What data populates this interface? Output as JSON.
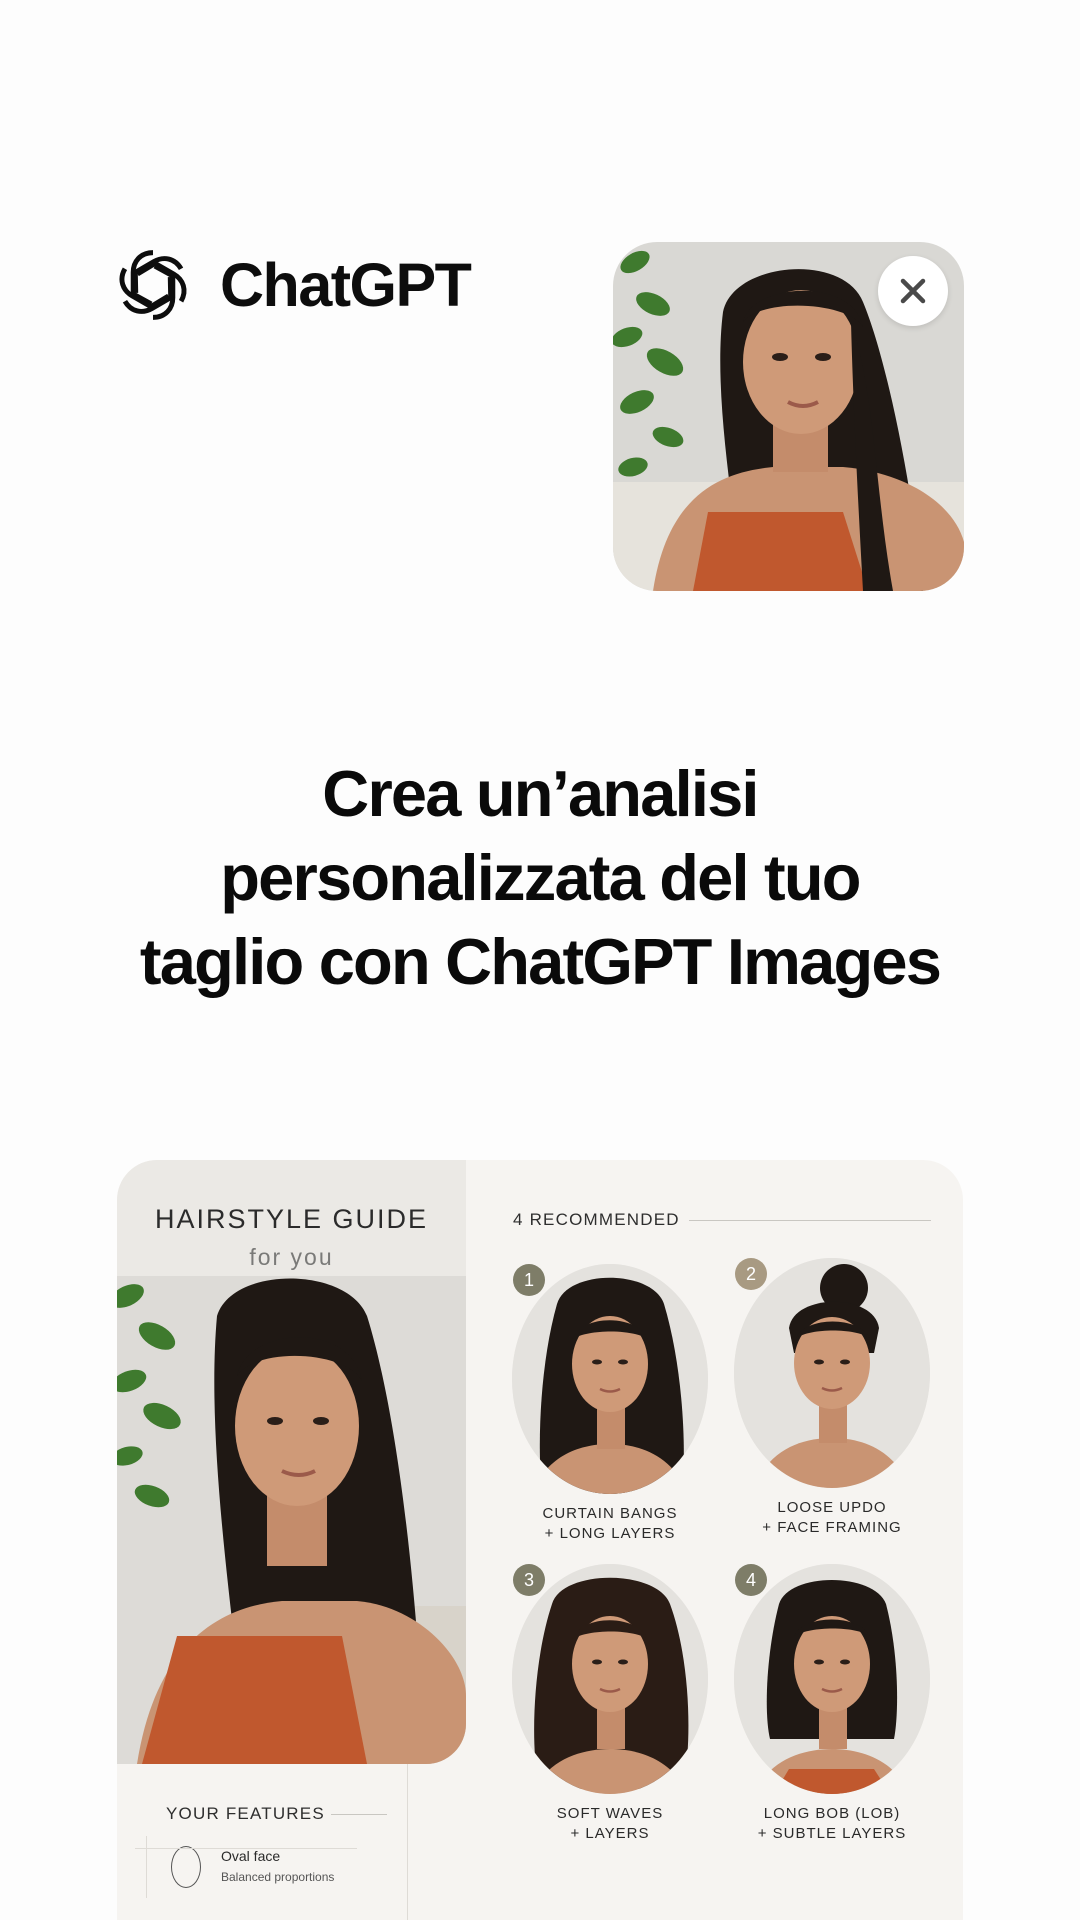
{
  "brand": {
    "name": "ChatGPT",
    "logo_icon": "openai-knot-icon"
  },
  "upload": {
    "close_icon": "close-icon"
  },
  "headline": {
    "line1": "Crea un’analisi",
    "line2": "personalizzata del tuo",
    "line3": "taglio con ChatGPT Images"
  },
  "guide": {
    "title": "HAIRSTYLE GUIDE",
    "subtitle": "for you",
    "recommended_header": "4 RECOMMENDED",
    "looks": [
      {
        "number": "1",
        "line1": "CURTAIN BANGS",
        "line2": "+ LONG LAYERS"
      },
      {
        "number": "2",
        "line1": "LOOSE UPDO",
        "line2": "+ FACE FRAMING"
      },
      {
        "number": "3",
        "line1": "SOFT WAVES",
        "line2": "+ LAYERS"
      },
      {
        "number": "4",
        "line1": "LONG BOB (LOB)",
        "line2": "+ SUBTLE LAYERS"
      }
    ],
    "features_header": "YOUR FEATURES",
    "features": [
      {
        "name": "Oval face",
        "desc": "Balanced proportions",
        "icon": "oval-face-icon"
      }
    ]
  },
  "colors": {
    "background": "#fdfdfd",
    "text": "#0d0d0d",
    "card": "#f6f4f1",
    "badge_olive": "#7e7d68",
    "badge_tan": "#a89a82",
    "top_orange": "#c0582e"
  }
}
